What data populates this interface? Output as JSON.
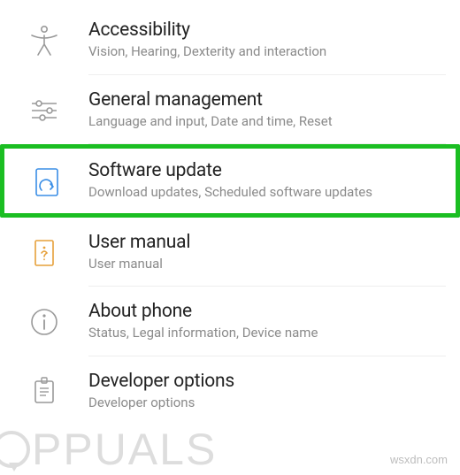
{
  "settings": [
    {
      "id": "accessibility",
      "title": "Accessibility",
      "subtitle": "Vision, Hearing, Dexterity and interaction",
      "icon": "accessibility-icon",
      "highlighted": false
    },
    {
      "id": "general-management",
      "title": "General management",
      "subtitle": "Language and input, Date and time, Reset",
      "icon": "sliders-icon",
      "highlighted": false
    },
    {
      "id": "software-update",
      "title": "Software update",
      "subtitle": "Download updates, Scheduled software updates",
      "icon": "update-icon",
      "highlighted": true
    },
    {
      "id": "user-manual",
      "title": "User manual",
      "subtitle": "User manual",
      "icon": "manual-icon",
      "highlighted": false
    },
    {
      "id": "about-phone",
      "title": "About phone",
      "subtitle": "Status, Legal information, Device name",
      "icon": "info-icon",
      "highlighted": false
    },
    {
      "id": "developer-options",
      "title": "Developer options",
      "subtitle": "Developer options",
      "icon": "developer-icon",
      "highlighted": false
    }
  ],
  "watermark_left": "PPUALS",
  "watermark_right": "wsxdn.com",
  "highlight_color": "#1bbe22"
}
